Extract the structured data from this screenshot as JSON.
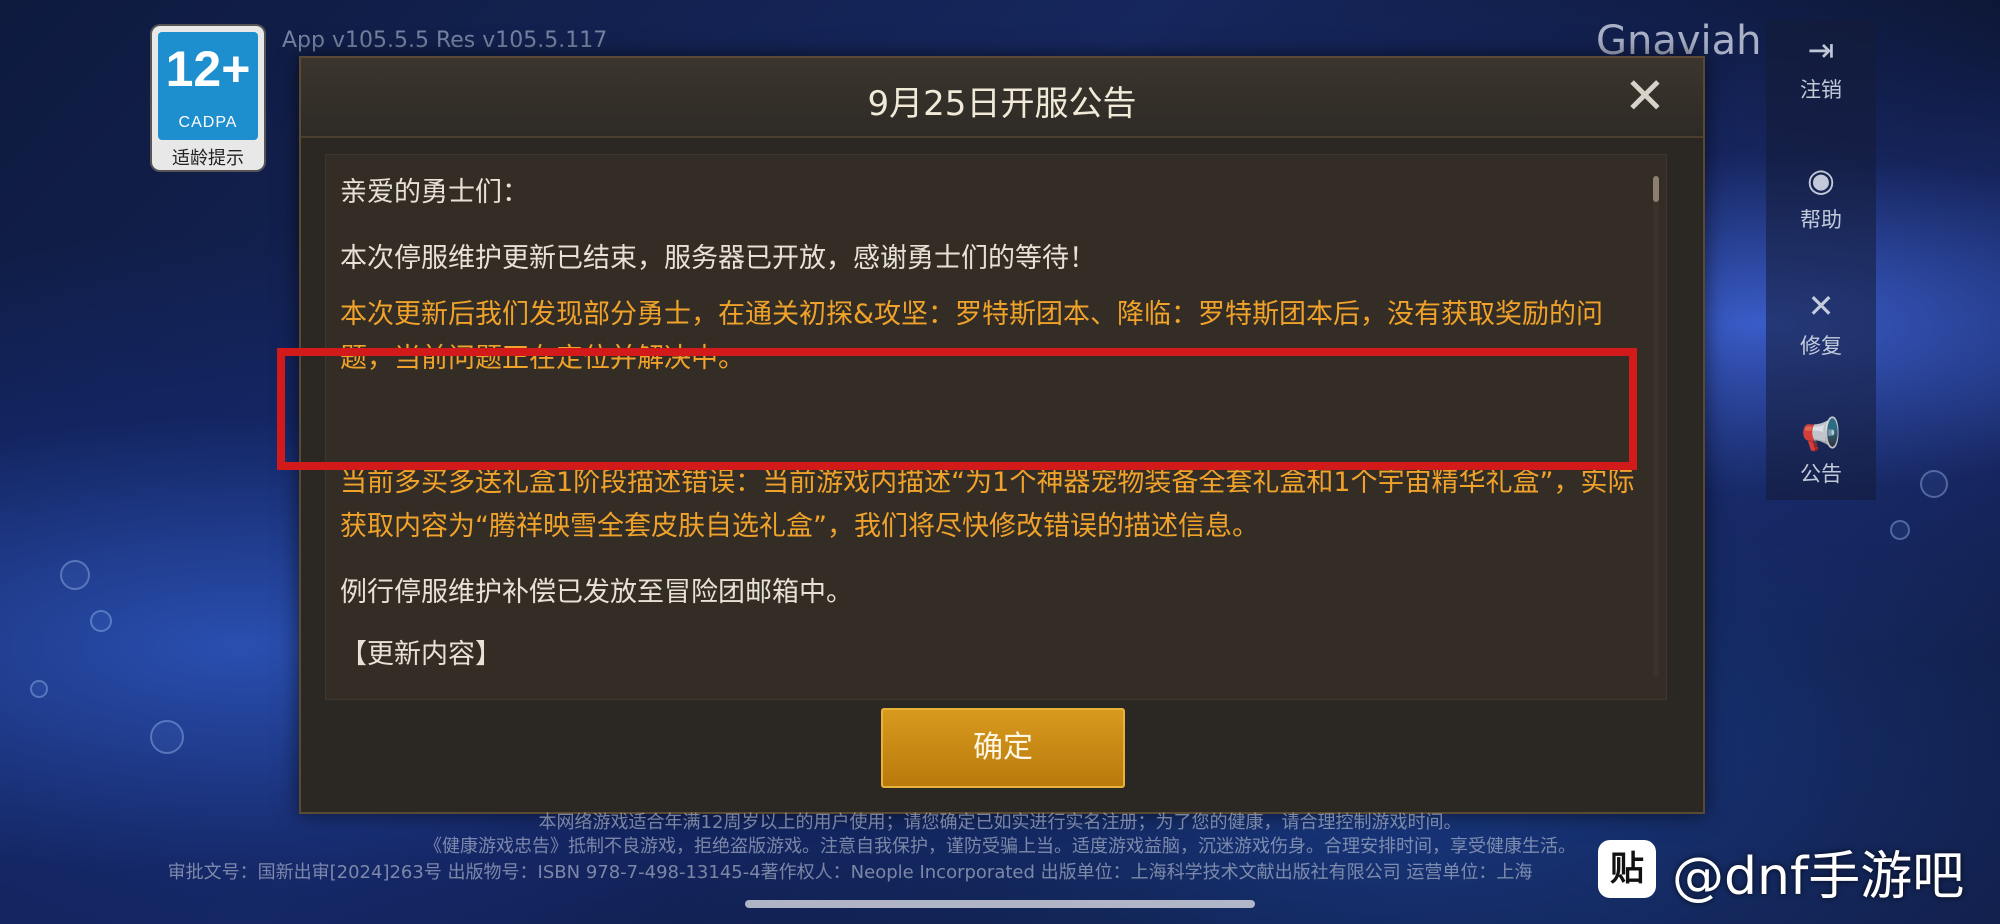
{
  "hud": {
    "version": "App v105.5.5 Res v105.5.117",
    "server_name": "Gnaviah",
    "age_rating": {
      "number": "12+",
      "org": "CADPA",
      "tip": "适龄提示"
    }
  },
  "side_menu": [
    {
      "label": "注销",
      "icon": "logout-icon",
      "glyph": "⇥"
    },
    {
      "label": "帮助",
      "icon": "help-icon",
      "glyph": "◉"
    },
    {
      "label": "修复",
      "icon": "repair-icon",
      "glyph": "✕"
    },
    {
      "label": "公告",
      "icon": "announcement-icon",
      "glyph": "📢"
    }
  ],
  "dialog": {
    "title": "9月25日开服公告",
    "paragraphs": [
      {
        "text": "亲爱的勇士们：",
        "color": "white"
      },
      {
        "text": "本次停服维护更新已结束，服务器已开放，感谢勇士们的等待！",
        "color": "white"
      },
      {
        "text": "本次更新后我们发现部分勇士，在通关初探&攻坚：罗特斯团本、降临：罗特斯团本后，没有获取奖励的问题，当前问题正在定位并解决中。",
        "color": "orange"
      },
      {
        "text": "当前多买多送礼盒1阶段描述错误：当前游戏内描述“为1个神器宠物装备全套礼盒和1个宇宙精华礼盒”，实际获取内容为“腾祥映雪全套皮肤自选礼盒”，我们将尽快修改错误的描述信息。",
        "color": "orange"
      },
      {
        "text": "例行停服维护补偿已发放至冒险团邮箱中。",
        "color": "white"
      },
      {
        "text": "【更新内容】",
        "color": "white"
      }
    ],
    "confirm_label": "确定"
  },
  "footer": {
    "line1": "本网络游戏适合年满12周岁以上的用户使用；请您确定已如实进行实名注册；为了您的健康，请合理控制游戏时间。",
    "line2": "《健康游戏忠告》抵制不良游戏，拒绝盗版游戏。注意自我保护，谨防受骗上当。适度游戏益脑，沉迷游戏伤身。合理安排时间，享受健康生活。",
    "line3": "审批文号：国新出审[2024]263号  出版物号：ISBN 978-7-498-13145-4著作权人：Neople Incorporated 出版单位：上海科学技术文献出版社有限公司 运营单位：上海",
    "watermark": "@dnf手游吧",
    "watermark_logo": "贴"
  },
  "colors": {
    "accent_orange": "#f0a22a",
    "highlight_red": "#d21a1a",
    "button_gold": "#c98a14"
  }
}
